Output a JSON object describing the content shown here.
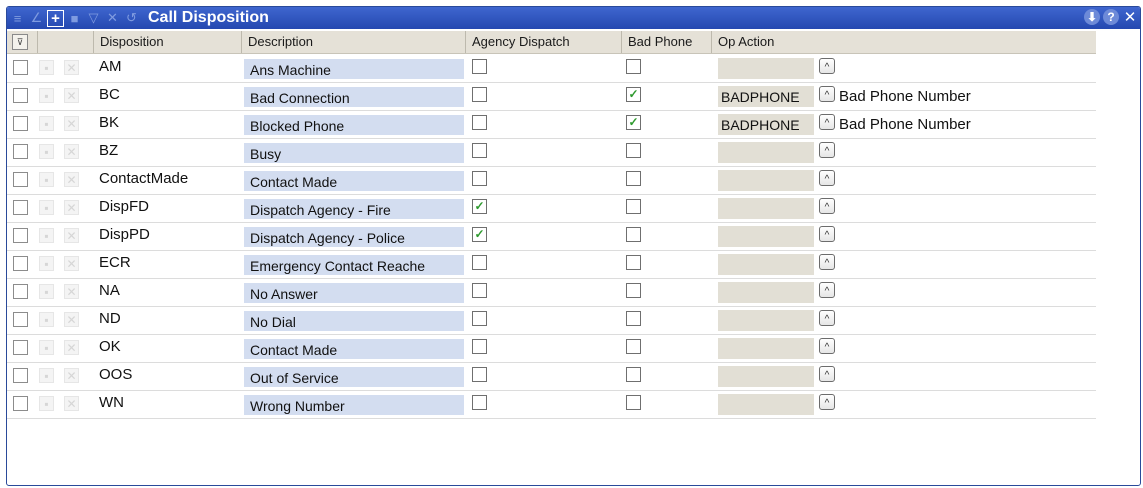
{
  "window": {
    "title": "Call Disposition",
    "toolbar_icons": [
      "list-icon",
      "edit-icon",
      "add-icon",
      "save-icon",
      "filter-icon",
      "delete-icon",
      "refresh-icon"
    ],
    "controls": {
      "collapse": "⬇",
      "help": "?",
      "close": "✕"
    }
  },
  "columns": {
    "filter": "⊽",
    "disposition": "Disposition",
    "description": "Description",
    "agency_dispatch": "Agency Dispatch",
    "bad_phone": "Bad Phone",
    "op_action": "Op Action"
  },
  "rows": [
    {
      "code": "AM",
      "description": "Ans Machine",
      "agency_dispatch": false,
      "bad_phone": false,
      "op_action": "",
      "op_action_desc": ""
    },
    {
      "code": "BC",
      "description": "Bad Connection",
      "agency_dispatch": false,
      "bad_phone": true,
      "op_action": "BADPHONE",
      "op_action_desc": "Bad Phone Number"
    },
    {
      "code": "BK",
      "description": "Blocked Phone",
      "agency_dispatch": false,
      "bad_phone": true,
      "op_action": "BADPHONE",
      "op_action_desc": "Bad Phone Number"
    },
    {
      "code": "BZ",
      "description": "Busy",
      "agency_dispatch": false,
      "bad_phone": false,
      "op_action": "",
      "op_action_desc": ""
    },
    {
      "code": "ContactMade",
      "description": "Contact Made",
      "agency_dispatch": false,
      "bad_phone": false,
      "op_action": "",
      "op_action_desc": ""
    },
    {
      "code": "DispFD",
      "description": "Dispatch Agency - Fire",
      "agency_dispatch": true,
      "bad_phone": false,
      "op_action": "",
      "op_action_desc": ""
    },
    {
      "code": "DispPD",
      "description": "Dispatch Agency - Police",
      "agency_dispatch": true,
      "bad_phone": false,
      "op_action": "",
      "op_action_desc": ""
    },
    {
      "code": "ECR",
      "description": "Emergency Contact Reache",
      "agency_dispatch": false,
      "bad_phone": false,
      "op_action": "",
      "op_action_desc": ""
    },
    {
      "code": "NA",
      "description": "No Answer",
      "agency_dispatch": false,
      "bad_phone": false,
      "op_action": "",
      "op_action_desc": ""
    },
    {
      "code": "ND",
      "description": "No Dial",
      "agency_dispatch": false,
      "bad_phone": false,
      "op_action": "",
      "op_action_desc": ""
    },
    {
      "code": "OK",
      "description": "Contact Made",
      "agency_dispatch": false,
      "bad_phone": false,
      "op_action": "",
      "op_action_desc": ""
    },
    {
      "code": "OOS",
      "description": "Out of Service",
      "agency_dispatch": false,
      "bad_phone": false,
      "op_action": "",
      "op_action_desc": ""
    },
    {
      "code": "WN",
      "description": "Wrong Number",
      "agency_dispatch": false,
      "bad_phone": false,
      "op_action": "",
      "op_action_desc": ""
    }
  ],
  "colors": {
    "title_bar": "#2f55c0",
    "header_bg": "#e5e1d7",
    "description_bg": "#d3ddf0",
    "check_green": "#2e9a2e"
  }
}
